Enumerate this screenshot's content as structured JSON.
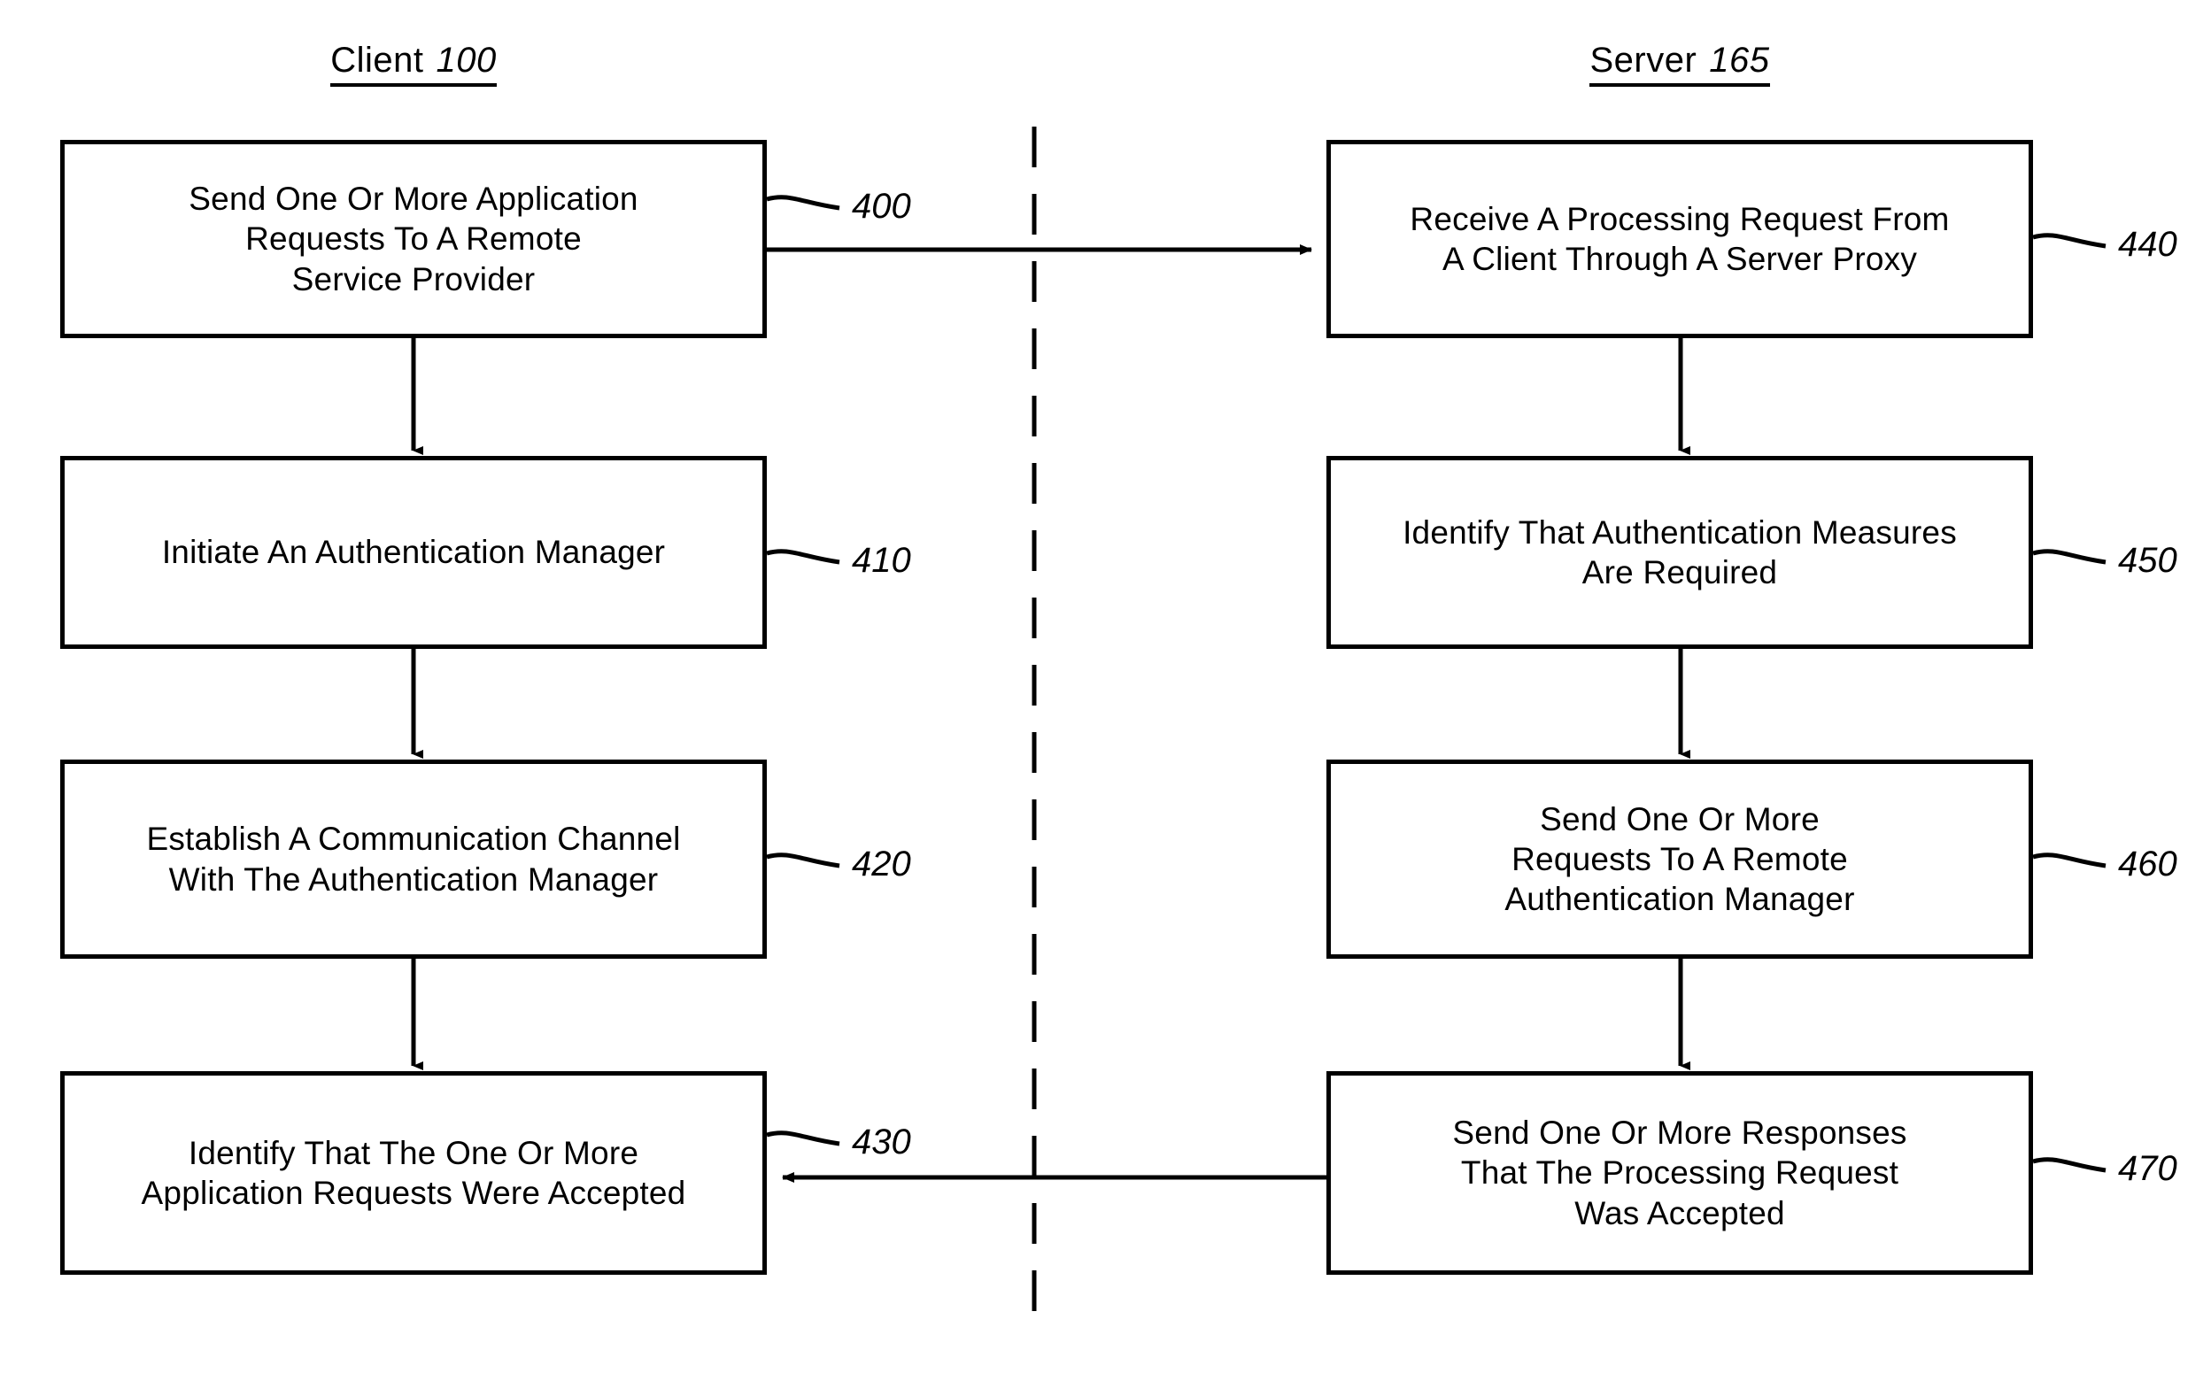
{
  "figure": {
    "type": "patent-flowchart",
    "background_color": "#ffffff",
    "line_color": "#000000",
    "columns": [
      {
        "id": "client",
        "label": "Client",
        "ref": "100"
      },
      {
        "id": "server",
        "label": "Server",
        "ref": "165"
      }
    ]
  },
  "client_column": {
    "heading_label": "Client",
    "heading_ref": "100",
    "steps": [
      {
        "ref": "400",
        "lines": [
          "Send One Or More Application",
          "Requests To A Remote",
          "Service Provider"
        ]
      },
      {
        "ref": "410",
        "lines": [
          "Initiate An Authentication Manager"
        ]
      },
      {
        "ref": "420",
        "lines": [
          "Establish A Communication Channel",
          "With The Authentication Manager"
        ]
      },
      {
        "ref": "430",
        "lines": [
          "Identify That The One Or More",
          "Application Requests Were Accepted"
        ]
      }
    ]
  },
  "server_column": {
    "heading_label": "Server",
    "heading_ref": "165",
    "steps": [
      {
        "ref": "440",
        "lines": [
          "Receive A Processing Request From",
          "A Client Through A Server Proxy"
        ]
      },
      {
        "ref": "450",
        "lines": [
          "Identify That Authentication Measures",
          "Are Required"
        ]
      },
      {
        "ref": "460",
        "lines": [
          "Send One Or More",
          "Requests To A Remote",
          "Authentication Manager"
        ]
      },
      {
        "ref": "470",
        "lines": [
          "Send One Or More Responses",
          "That The Processing Request",
          "Was Accepted"
        ]
      }
    ]
  },
  "connectors": {
    "client_vertical": [
      {
        "from": "400",
        "to": "410"
      },
      {
        "from": "410",
        "to": "420"
      },
      {
        "from": "420",
        "to": "430"
      }
    ],
    "server_vertical": [
      {
        "from": "440",
        "to": "450"
      },
      {
        "from": "450",
        "to": "460"
      },
      {
        "from": "460",
        "to": "470"
      }
    ],
    "cross": [
      {
        "from": "400",
        "to": "440",
        "direction": "right"
      },
      {
        "from": "470",
        "to": "430",
        "direction": "left"
      }
    ],
    "divider": {
      "style": "dashed",
      "orientation": "vertical"
    }
  }
}
